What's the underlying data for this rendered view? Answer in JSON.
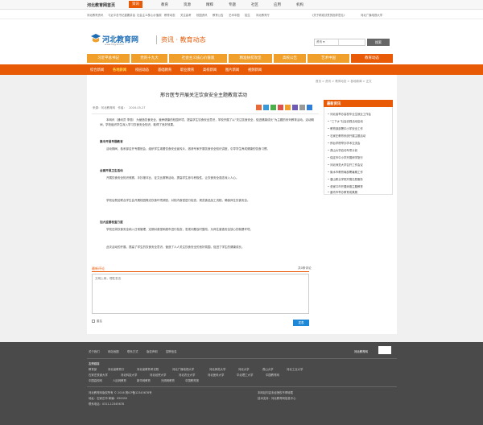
{
  "topbar": {
    "brand": "河北教育网首页",
    "items": [
      "资讯",
      "教育",
      "资源",
      "精粹",
      "专题",
      "社区",
      "应用",
      "机构"
    ],
    "active_index": 0
  },
  "subbar": {
    "links": [
      "河北教育资讯",
      "习近平总书记重要讲话",
      "社会主义核心价值观",
      "教育动态",
      "关注高考",
      "校园资讯",
      "教育公告",
      "艺术中国",
      "招生",
      "河北教育厅"
    ],
    "right": [
      "《关于精准扶贫的指导意见》",
      "河北广播电视大学"
    ]
  },
  "header": {
    "logo_text": "河北教育网",
    "logo_url": "www.hbjyw.com",
    "section_title": "资讯 · 教育动态",
    "search_select": "资讯",
    "search_placeholder": "",
    "search_button": "搜索"
  },
  "nav1": {
    "tabs": [
      "习近平总书记",
      "党的十九大",
      "社会主义核心价值观",
      "精准扶贫攻坚",
      "高校公告",
      "艺术中国",
      "教育动态"
    ],
    "active_index": 6
  },
  "nav2": {
    "links": [
      "综合新闻",
      "各地新闻",
      "校园动态",
      "基础教育",
      "职业教育",
      "高校新闻",
      "图片新闻",
      "视频新闻"
    ],
    "active_index": 1
  },
  "breadcrumb": "首页 > 资讯 > 教育动态 > 各地新闻 > 正文",
  "article": {
    "title": "邢台医专开展关注饮食安全主题教育活动",
    "source": "来源：河北教育网",
    "author": "作者：",
    "date": "2016-05-27",
    "subheads": [
      "集中开展专题教育",
      "全面开展卫生活动",
      "加大监督检查力度"
    ],
    "paragraphs": [
      "本网讯（通讯员 李丽） 为营造饮食安全、营养健康的校园环境，提高学生饮食安全意识，学校开展了以“关注饮食安全，促进健康成长”为主题的系列教育活动。活动期间，学校组织学生深入学习饮食安全知识，取得了良好效果。",
      "活动期间，各系部召开专题班会，组织学生观看饮食安全宣传片，邀请专家开展饮食安全知识讲座，引导学生养成健康的饮食习惯。",
      "开展饮食安全知识竞赛、手抄报评比、征文比赛等活动，提高学生参与积极性，让饮食安全观念深入人心。",
      "学校后勤处联合学生会开展校园周边饮食环境调查，对校内食堂进行检查，规范食品加工流程，确保师生饮食安全。",
      "学校还将饮食安全纳入日常管理，定期对食堂和超市进行检查，发现问题及时整改，为师生营造安全放心的就餐环境。",
      "此次活动的开展，提高了学生的饮食安全意识，营造了人人关注饮食安全的良好氛围，促进了学生的健康成长。"
    ]
  },
  "sidebar": {
    "title": "最新资讯",
    "items": [
      "河北省举办高校毕业生就业工作会",
      "“三下乡”社会实践活动启动",
      "教育部部署中小学安全工作",
      "石家庄教育系统开展主题活动",
      "邢台学院举办学术交流会",
      "燕山大学启动专项计划",
      "保定市中小学开展研学旅行",
      "河北师范大学召开工作会议",
      "衡水市教育局部署暑期工作",
      "唐山职业学院开展志愿服务",
      "张家口市开展师德主题教育",
      "廊坊市举办教育成果展"
    ]
  },
  "comment": {
    "heading": "最新评论",
    "count": "共0条评论",
    "placeholder": "文明上网，理性发言",
    "anon": "匿名",
    "submit": "发表"
  },
  "footer": {
    "links": [
      "关于我们",
      "网站地图",
      "联系方式",
      "版权声明",
      "招聘信息"
    ],
    "qr_title": "河北教育网",
    "friend_title": "友情链接",
    "friends_row1": [
      "教育部",
      "河北省教育厅",
      "河北省教育考试院",
      "河北广播电视大学",
      "河北师范大学",
      "河北大学",
      "燕山大学",
      "河北工业大学"
    ],
    "friends_row2": [
      "石家庄铁道大学",
      "河北科技大学",
      "河北经贸大学",
      "河北农业大学",
      "河北医科大学",
      "华北理工大学",
      "中国教育网"
    ],
    "friends_row3": [
      "中国高校网",
      "人民网教育",
      "新华网教育",
      "光明网教育",
      "中国教育报"
    ],
    "copyright1": "河北教育网版权所有 © 2016 冀ICP备12345678号",
    "copyright2": "地址：石家庄市 邮编：050000",
    "copyright3": "联系电话：0311-12345678",
    "copyright_right1": "本网站内容未经授权不得转载",
    "copyright_right2": "技术支持：河北教育网信息中心"
  }
}
